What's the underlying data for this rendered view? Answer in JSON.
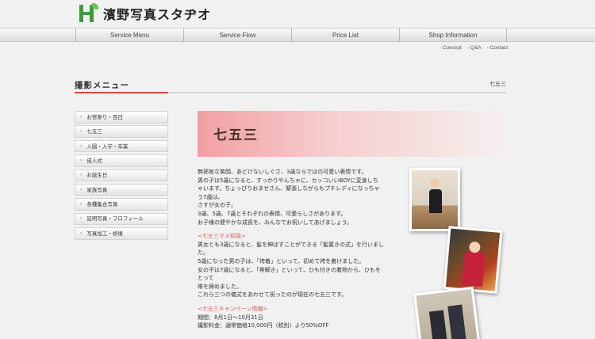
{
  "logo": {
    "text": "濱野写真スタヂオ",
    "icon": "h-logo-icon"
  },
  "nav": [
    "Service Menu",
    "Service Flow",
    "Price List",
    "Shop Information"
  ],
  "subnav": [
    "- Concept",
    "- Q&A",
    "- Contact"
  ],
  "heading": "撮影メニュー",
  "breadcrumb": "七五三",
  "sidebar": [
    "お宮参り・百日",
    "七五三",
    "入園・入学・卒業",
    "成人式",
    "お誕生日",
    "家族写真",
    "各種集合写真",
    "証明写真・プロフィール",
    "写真加工・修復"
  ],
  "banner_title": "七五三",
  "intro": [
    "無邪気な笑顔、あどけないしぐさ、3歳ならではの可愛い表情です。",
    "男の子は5歳になると、すっかりやんちゃに、カッコいいBOYに変身しち",
    "ゃいます。ちょっぴりおませさん、緊張しながらもプチレディになっちゃ",
    "う7歳は、",
    "さすが女の子。",
    "3歳、5歳、7歳とそれぞれの表情、可愛らしさがあります。",
    "お子様の健やかな成長を、みんなでお祝いしてあげましょう。"
  ],
  "mame_title": "<七五三マメ知識>",
  "mame": [
    "男女とも3歳になると、髪を伸ばすことができる「髪置きの式」を行いまし",
    "た。",
    "5歳になった男の子は、「袴着」といって、初めて袴を着けました。",
    "女の子は7歳になると、「帯解き」といって、ひも付きの着物から、ひもを",
    "とって",
    "帯を締めました。",
    "これら三つの儀式をあわせて祝ったのが現在の七五三です。"
  ],
  "campaign_title": "<七五三キャンペーン情報>",
  "campaign": [
    "期間：8月1日〜10月31日",
    "撮影料金：通常価格10,000円（税別）より50%OFF"
  ]
}
